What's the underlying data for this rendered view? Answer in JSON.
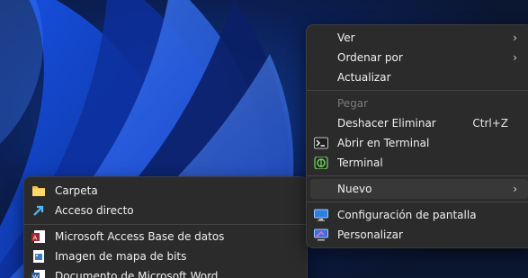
{
  "context_menu": {
    "items": [
      {
        "label": "Ver"
      },
      {
        "label": "Ordenar por"
      },
      {
        "label": "Actualizar"
      },
      {
        "label": "Pegar"
      },
      {
        "label": "Deshacer Eliminar",
        "shortcut": "Ctrl+Z"
      },
      {
        "label": "Abrir en Terminal"
      },
      {
        "label": "Terminal"
      },
      {
        "label": "Nuevo"
      },
      {
        "label": "Configuración de pantalla"
      },
      {
        "label": "Personalizar"
      }
    ]
  },
  "new_submenu": {
    "items": [
      {
        "label": "Carpeta"
      },
      {
        "label": "Acceso directo"
      },
      {
        "label": "Microsoft Access Base de datos"
      },
      {
        "label": "Imagen de mapa de bits"
      },
      {
        "label": "Documento de Microsoft Word"
      }
    ]
  },
  "colors": {
    "menu_background": "#2b2b2b",
    "menu_highlight": "#383838",
    "text": "#f0f0f0",
    "disabled_text": "#7c7c7c",
    "wallpaper_accent": "#1f6fff"
  }
}
